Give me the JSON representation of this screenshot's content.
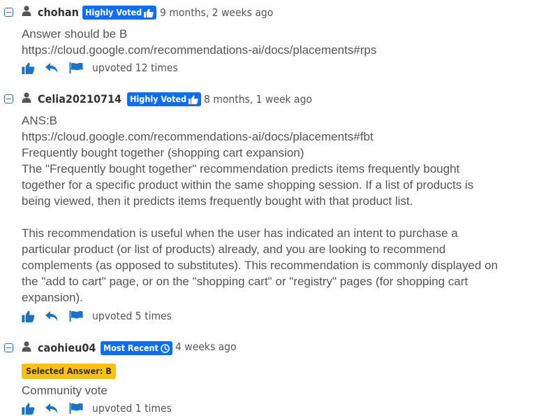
{
  "colors": {
    "accent": "#1a73c9",
    "badge_blue": "#0d6efd",
    "selected_yellow": "#ffc107",
    "text": "#555555"
  },
  "comments": [
    {
      "username": "chohan",
      "badge": "Highly Voted",
      "badge_icon": "thumbs-up-icon",
      "timestamp": "9 months, 2 weeks ago",
      "body": "Answer should be B\nhttps://cloud.google.com/recommendations-ai/docs/placements#rps",
      "upvotes": "upvoted 12 times"
    },
    {
      "username": "Celia20210714",
      "badge": "Highly Voted",
      "badge_icon": "thumbs-up-icon",
      "timestamp": "8 months, 1 week ago",
      "body": "ANS:B\nhttps://cloud.google.com/recommendations-ai/docs/placements#fbt\nFrequently bought together (shopping cart expansion)\nThe \"Frequently bought together\" recommendation predicts items frequently bought\ntogether for a specific product within the same shopping session. If a list of products is\nbeing viewed, then it predicts items frequently bought with that product list.\n\nThis recommendation is useful when the user has indicated an intent to purchase a\nparticular product (or list of products) already, and you are looking to recommend\ncomplements (as opposed to substitutes). This recommendation is commonly displayed on\nthe \"add to cart\" page, or on the \"shopping cart\" or \"registry\" pages (for shopping cart\nexpansion).",
      "upvotes": "upvoted 5 times"
    },
    {
      "username": "caohieu04",
      "badge": "Most Recent",
      "badge_icon": "clock-icon",
      "timestamp": "4 weeks ago",
      "selected_answer": "Selected Answer: B",
      "body": "Community vote",
      "upvotes": "upvoted 1 times"
    }
  ]
}
